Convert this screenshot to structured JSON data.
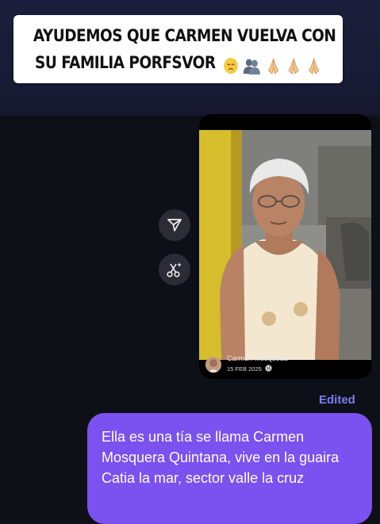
{
  "story_caption": {
    "line1": "AYUDEMOS QUE CARMEN VUELVA CON",
    "line2": "SU FAMILIA PORFSVOR",
    "emojis": [
      "pensive-face-emoji",
      "busts-in-silhouette-emoji",
      "folded-hands-emoji",
      "folded-hands-emoji",
      "folded-hands-emoji"
    ]
  },
  "shared_post": {
    "author": "Carmen Mosqueda",
    "date": "15 FEB 2025",
    "visibility_icon": "globe-icon"
  },
  "actions": {
    "share_icon": "send-icon",
    "cut_icon": "scissors-sparkle-icon"
  },
  "message": {
    "status": "Edited",
    "text": "Ella es una tía se llama Carmen Mosquera Quintana, vive en la guaira Catia la mar, sector valle la cruz"
  },
  "colors": {
    "background": "#0d1017",
    "top_band": "#1b1f3c",
    "bubble": "#7b51ef",
    "edited_label": "#7e7cf2",
    "action_button": "#2a2d36"
  }
}
